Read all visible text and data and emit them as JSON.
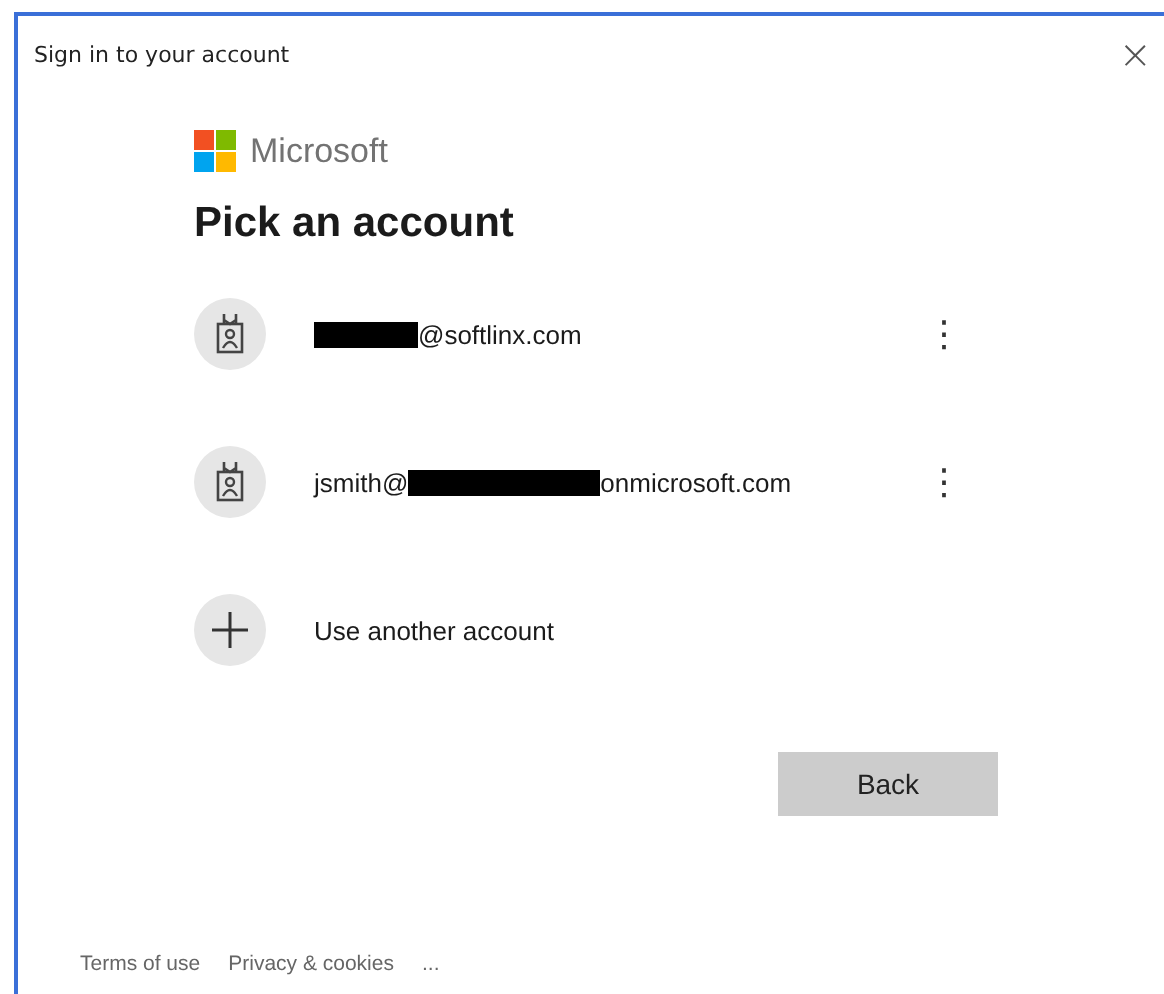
{
  "window": {
    "title": "Sign in to your account",
    "close": "×"
  },
  "brand": "Microsoft",
  "heading": "Pick an account",
  "accounts": [
    {
      "kind": "account",
      "segments": [
        {
          "kind": "redacted-short"
        },
        {
          "kind": "text",
          "text": "@softlinx.com"
        }
      ],
      "menu": "⋮"
    },
    {
      "kind": "account",
      "segments": [
        {
          "kind": "text",
          "text": "jsmith@"
        },
        {
          "kind": "redacted-long"
        },
        {
          "kind": "text",
          "text": "onmicrosoft.com"
        }
      ],
      "menu": "⋮"
    },
    {
      "kind": "add",
      "segments": [
        {
          "kind": "text",
          "text": "Use another account"
        }
      ]
    }
  ],
  "back_button": "Back",
  "footer": [
    "Terms of use",
    "Privacy & cookies",
    "..."
  ]
}
